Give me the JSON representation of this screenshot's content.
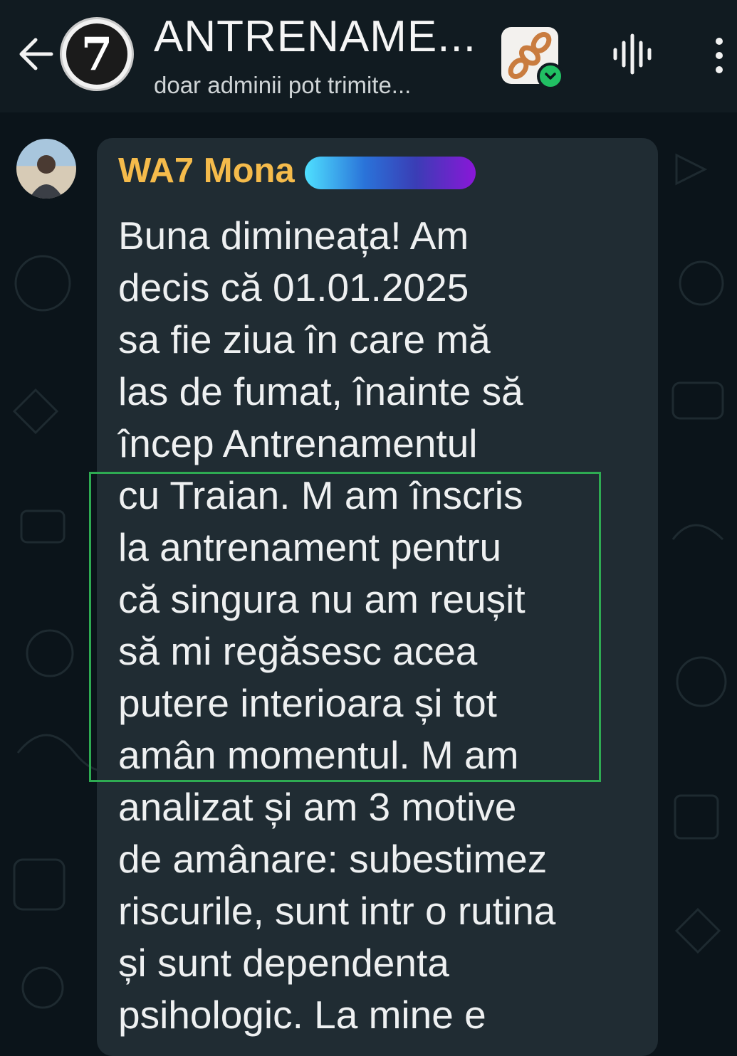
{
  "header": {
    "title": "ANTRENAME...",
    "subtitle": "doar adminii pot trimite...",
    "group_avatar_text": "7",
    "back_icon": "arrow-left-icon",
    "voice_icon": "voice-chat-icon",
    "menu_icon": "more-vertical-icon",
    "community_icon": "community-chain-icon"
  },
  "message": {
    "sender": "WA7 Mona",
    "lines": [
      "Buna dimineața! Am",
      "decis că 01.01.2025",
      "sa fie ziua în care mă",
      "las de fumat, înainte să",
      "încep Antrenamentul",
      "cu Traian. M am înscris",
      "la antrenament pentru",
      "că singura nu am reușit",
      "să mi regăsesc acea",
      "putere interioara și tot",
      "amân momentul. M am",
      "analizat și am 3 motive",
      "de amânare: subestimez",
      "riscurile, sunt intr o rutina",
      "și sunt dependenta",
      "psihologic. La mine e"
    ]
  },
  "colors": {
    "header_bg": "#111b21",
    "chat_bg": "#0b141a",
    "bubble_bg": "#202c33",
    "sender_color": "#f5bb4b",
    "highlight_border": "#2eab52",
    "online_badge": "#21c063"
  }
}
